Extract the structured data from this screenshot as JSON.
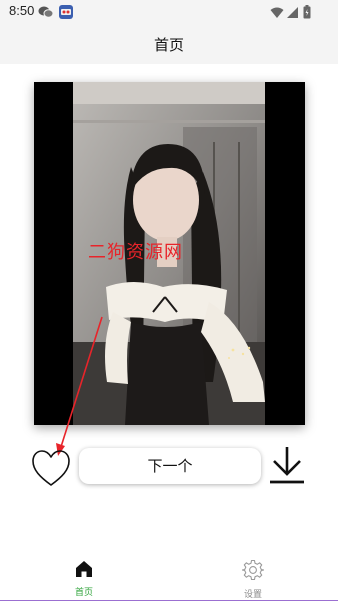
{
  "status_bar": {
    "time": "8:50",
    "left_icons": [
      "wechat-icon",
      "app-notification-icon"
    ],
    "right_icons": [
      "wifi-icon",
      "signal-icon",
      "battery-icon"
    ]
  },
  "header": {
    "title": "首页"
  },
  "video": {
    "watermark": "二狗资源网"
  },
  "actions": {
    "like_icon": "heart-outline-icon",
    "next_label": "下一个",
    "download_icon": "download-icon"
  },
  "tabbar": {
    "items": [
      {
        "label": "首页",
        "icon": "home-icon",
        "active": true
      },
      {
        "label": "设置",
        "icon": "gear-icon",
        "active": false
      }
    ],
    "active_color": "#2fa33a",
    "inactive_color": "#8a8a8a"
  },
  "colors": {
    "watermark": "#e8242a",
    "annotation_arrow": "#e8242a",
    "tabbar_border": "#9b6fd1"
  }
}
